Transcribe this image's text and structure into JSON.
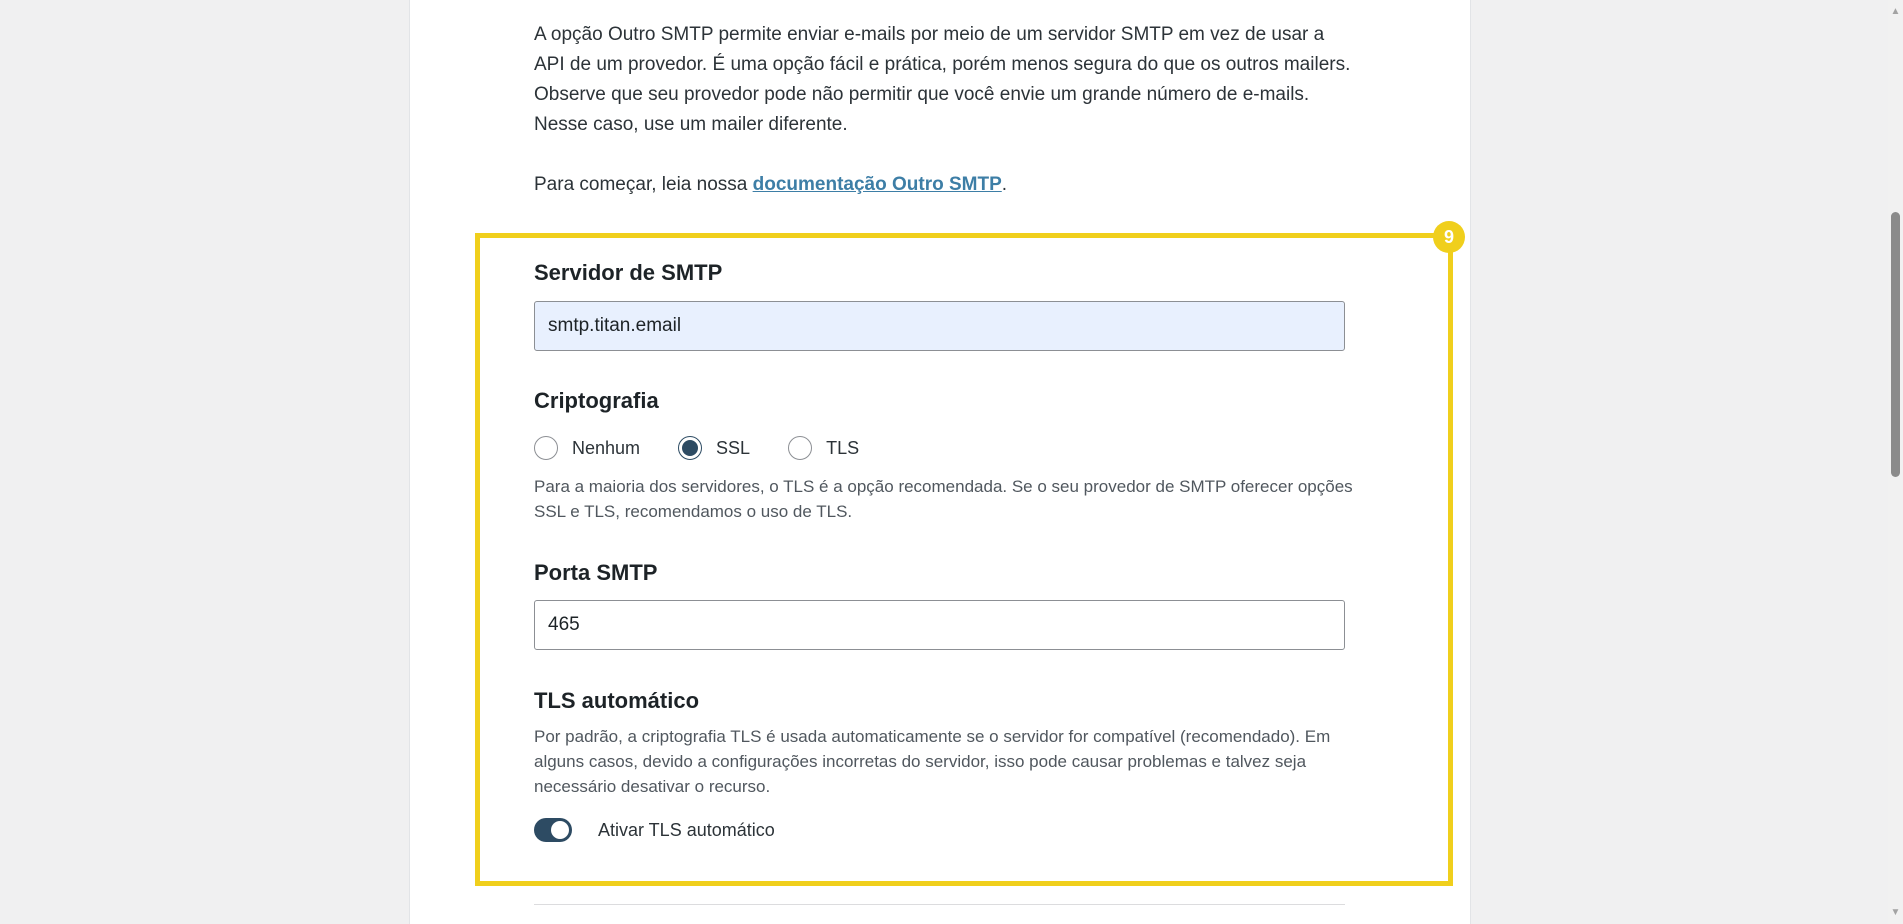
{
  "intro": {
    "paragraph": "A opção Outro SMTP permite enviar e-mails por meio de um servidor SMTP em vez de usar a API de um provedor. É uma opção fácil e prática, porém menos segura do que os outros mailers. Observe que seu provedor pode não permitir que você envie um grande número de e-mails. Nesse caso, use um mailer diferente.",
    "start_prefix": "Para começar, leia nossa ",
    "doc_link": "documentação Outro SMTP",
    "start_suffix": "."
  },
  "highlight": {
    "badge": "9",
    "color": "#f0cf1c"
  },
  "smtp_host": {
    "title": "Servidor de SMTP",
    "value": "smtp.titan.email"
  },
  "encryption": {
    "title": "Criptografia",
    "options": [
      {
        "label": "Nenhum",
        "checked": false
      },
      {
        "label": "SSL",
        "checked": true
      },
      {
        "label": "TLS",
        "checked": false
      }
    ],
    "description": "Para a maioria dos servidores, o TLS é a opção recomendada. Se o seu provedor de SMTP oferecer opções SSL e TLS, recomendamos o uso de TLS."
  },
  "smtp_port": {
    "title": "Porta SMTP",
    "value": "465"
  },
  "auto_tls": {
    "title": "TLS automático",
    "description": "Por padrão, a criptografia TLS é usada automaticamente se o servidor for compatível (recomendado). Em alguns casos, devido a configurações incorretas do servidor, isso pode causar problemas e talvez seja necessário desativar o recurso.",
    "toggle_label": "Ativar TLS automático",
    "enabled": true
  },
  "colors": {
    "accent": "#2d4b63",
    "link": "#3d7ea6",
    "autofill_bg": "#e8f0fe"
  }
}
